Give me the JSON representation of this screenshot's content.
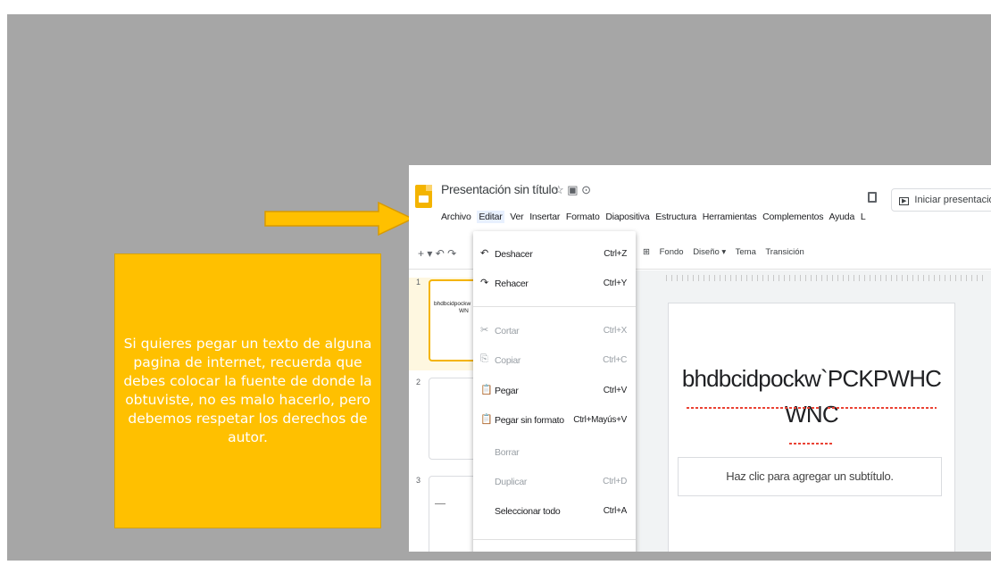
{
  "note": {
    "text": "Si quieres pegar un texto de alguna pagina de internet, recuerda que debes colocar la fuente de donde la obtuviste, no es malo hacerlo, pero debemos respetar los derechos de autor."
  },
  "screenshot": {
    "doc_title": "Presentación sin título",
    "title_icons": "☆ ▣ ⊙",
    "menus": [
      "Archivo",
      "Editar",
      "Ver",
      "Insertar",
      "Formato",
      "Diapositiva",
      "Estructura",
      "Herramientas",
      "Complementos",
      "Ayuda",
      "L"
    ],
    "present_label": "Iniciar presentación",
    "toolbar_left": "+ ▾ ↶ ↷",
    "toolbar_right": {
      "add": "⊞",
      "fondo": "Fondo",
      "diseno": "Diseño ▾",
      "tema": "Tema",
      "transicion": "Transición"
    },
    "thumbnails": [
      {
        "num": "1",
        "line1": "bhdbcidpockw",
        "line2": "WN"
      },
      {
        "num": "2"
      },
      {
        "num": "3"
      }
    ],
    "slide_title_line1": "bhdbcidpockw`PCKPWHC",
    "slide_title_line2": "WNC",
    "subtitle_placeholder": "Haz clic para agregar un subtítulo."
  },
  "edit_menu": {
    "items": [
      {
        "icon": "↶",
        "label": "Deshacer",
        "shortcut": "Ctrl+Z",
        "enabled": true
      },
      {
        "icon": "↷",
        "label": "Rehacer",
        "shortcut": "Ctrl+Y",
        "enabled": true
      },
      {
        "icon": "✂",
        "label": "Cortar",
        "shortcut": "Ctrl+X",
        "enabled": false
      },
      {
        "icon": "⎘",
        "label": "Copiar",
        "shortcut": "Ctrl+C",
        "enabled": false
      },
      {
        "icon": "📋",
        "label": "Pegar",
        "shortcut": "Ctrl+V",
        "enabled": true
      },
      {
        "icon": "📋",
        "label": "Pegar sin formato",
        "shortcut": "Ctrl+Mayús+V",
        "enabled": true
      },
      {
        "icon": "",
        "label": "Borrar",
        "shortcut": "",
        "enabled": false
      },
      {
        "icon": "",
        "label": "Duplicar",
        "shortcut": "Ctrl+D",
        "enabled": false
      },
      {
        "icon": "",
        "label": "Seleccionar todo",
        "shortcut": "Ctrl+A",
        "enabled": true
      }
    ]
  },
  "colors": {
    "background": "#a6a6a6",
    "note": "#ffc000",
    "arrow": "#ffc000",
    "slides_brand": "#f4b400"
  }
}
